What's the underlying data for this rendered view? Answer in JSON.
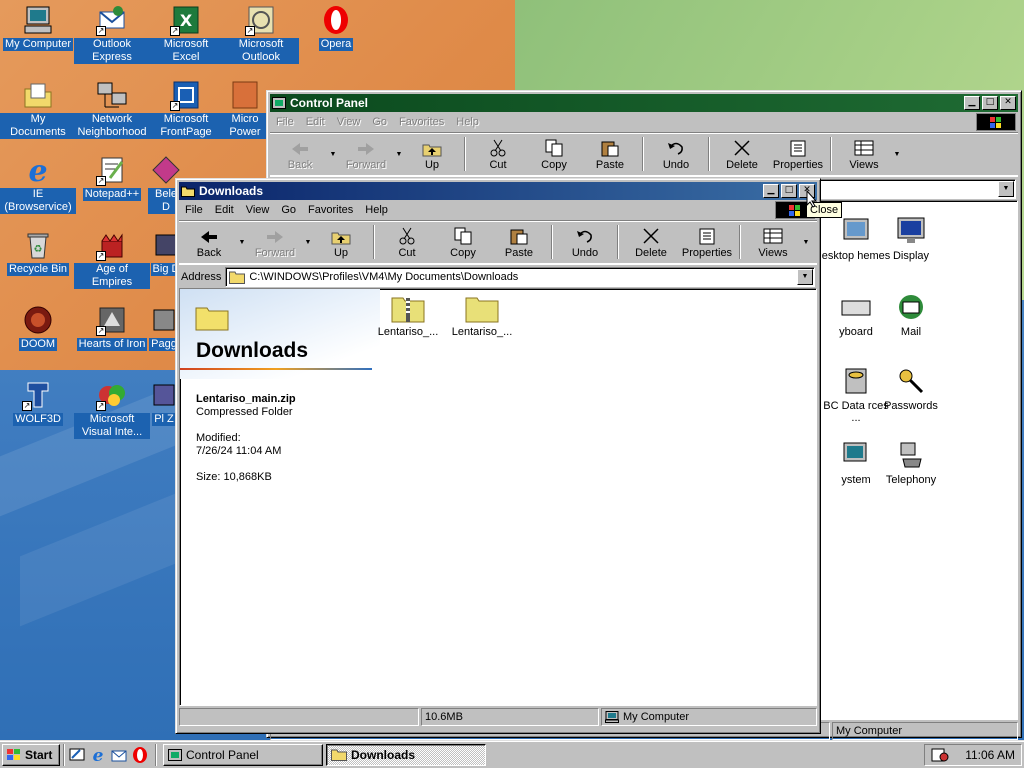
{
  "desktop": {
    "icons": [
      {
        "label": "My Computer",
        "icon": "my-computer-icon"
      },
      {
        "label": "Outlook Express",
        "icon": "outlook-express-icon"
      },
      {
        "label": "Microsoft Excel",
        "icon": "excel-icon"
      },
      {
        "label": "Microsoft Outlook",
        "icon": "outlook-icon"
      },
      {
        "label": "Opera",
        "icon": "opera-icon"
      },
      {
        "label": "My Documents",
        "icon": "my-documents-icon"
      },
      {
        "label": "Network Neighborhood",
        "icon": "network-icon"
      },
      {
        "label": "Microsoft FrontPage",
        "icon": "frontpage-icon"
      },
      {
        "label": "Micro Power",
        "icon": "powerpoint-icon"
      },
      {
        "label": "IE (Browservice)",
        "icon": "ie-icon"
      },
      {
        "label": "Notepad++",
        "icon": "notepad-icon"
      },
      {
        "label": "Bele D",
        "icon": "bele-icon"
      },
      {
        "label": "Recycle Bin",
        "icon": "recycle-bin-icon"
      },
      {
        "label": "Age of Empires",
        "icon": "age-of-empires-icon"
      },
      {
        "label": "Big D",
        "icon": "big-icon"
      },
      {
        "label": "DOOM",
        "icon": "doom-icon"
      },
      {
        "label": "Hearts of Iron",
        "icon": "hearts-of-iron-icon"
      },
      {
        "label": "Pagg",
        "icon": "pagg-icon"
      },
      {
        "label": "WOLF3D",
        "icon": "wolf3d-icon"
      },
      {
        "label": "Microsoft Visual Inte...",
        "icon": "visual-interdev-icon"
      },
      {
        "label": "Pl Z",
        "icon": "pl-icon"
      }
    ]
  },
  "control_panel": {
    "title": "Control Panel",
    "menu": [
      "File",
      "Edit",
      "View",
      "Go",
      "Favorites",
      "Help"
    ],
    "toolbar": [
      "Back",
      "Forward",
      "Up",
      "Cut",
      "Copy",
      "Paste",
      "Undo",
      "Delete",
      "Properties",
      "Views"
    ],
    "items": [
      {
        "label": "esktop hemes",
        "icon": "desktop-themes-icon"
      },
      {
        "label": "Display",
        "icon": "display-icon"
      },
      {
        "label": "yboard",
        "icon": "keyboard-icon"
      },
      {
        "label": "Mail",
        "icon": "mail-icon"
      },
      {
        "label": "BC Data rces ...",
        "icon": "odbc-icon"
      },
      {
        "label": "Passwords",
        "icon": "passwords-icon"
      },
      {
        "label": "ystem",
        "icon": "system-icon"
      },
      {
        "label": "Telephony",
        "icon": "telephony-icon"
      }
    ],
    "status_location": "My Computer"
  },
  "downloads": {
    "title": "Downloads",
    "menu": [
      "File",
      "Edit",
      "View",
      "Go",
      "Favorites",
      "Help"
    ],
    "toolbar": {
      "back": "Back",
      "forward": "Forward",
      "up": "Up",
      "cut": "Cut",
      "copy": "Copy",
      "paste": "Paste",
      "undo": "Undo",
      "delete": "Delete",
      "properties": "Properties",
      "views": "Views"
    },
    "address_label": "Address",
    "address_value": "C:\\WINDOWS\\Profiles\\VM4\\My Documents\\Downloads",
    "sidebar": {
      "folder_title": "Downloads",
      "selected_name": "Lentariso_main.zip",
      "selected_type": "Compressed Folder",
      "modified_label": "Modified:",
      "modified_value": "7/26/24 11:04 AM",
      "size_text": "Size: 10,868KB"
    },
    "files": [
      {
        "label": "Lentariso_...",
        "icon": "zip-folder-icon"
      },
      {
        "label": "Lentariso_...",
        "icon": "folder-icon"
      }
    ],
    "status_size": "10.6MB",
    "status_location": "My Computer",
    "tooltip": "Close"
  },
  "taskbar": {
    "start_label": "Start",
    "tasks": [
      {
        "label": "Control Panel",
        "pressed": false
      },
      {
        "label": "Downloads",
        "pressed": true
      }
    ],
    "clock": "11:06 AM"
  },
  "colors": {
    "active_title": "#0a246a",
    "inactive_title": "#0b4a1e",
    "face": "#c0c0c0",
    "icon_label_bg": "#1c62b0"
  }
}
